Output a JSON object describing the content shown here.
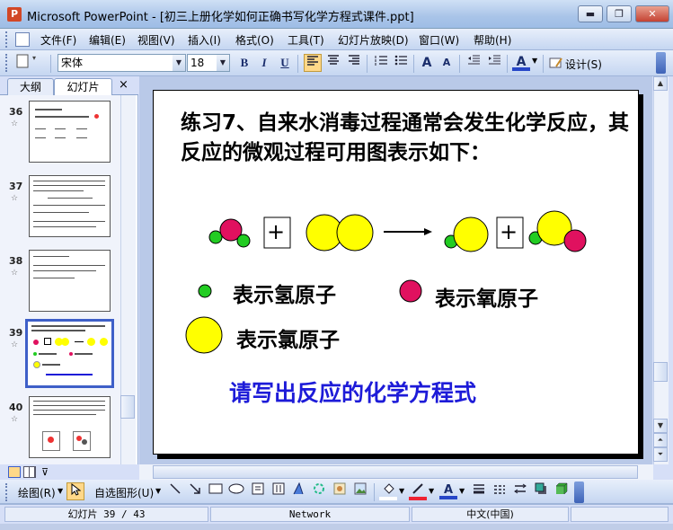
{
  "window": {
    "title": "Microsoft PowerPoint - [初三上册化学如何正确书写化学方程式课件.ppt]",
    "minimize": "▬",
    "maximize": "❐",
    "close": "✕"
  },
  "menu": [
    "文件(F)",
    "编辑(E)",
    "视图(V)",
    "插入(I)",
    "格式(O)",
    "工具(T)",
    "幻灯片放映(D)",
    "窗口(W)",
    "帮助(H)"
  ],
  "toolbar": {
    "font": "宋体",
    "size": "18",
    "bold": "B",
    "italic": "I",
    "underline": "U",
    "grow_font": "A",
    "shrink_font": "A",
    "font_color": "A",
    "design": "设计(S)"
  },
  "pane": {
    "tabs": [
      "大纲",
      "幻灯片"
    ],
    "close": "×",
    "slides": [
      {
        "number": "36",
        "star": "☆"
      },
      {
        "number": "37",
        "star": "☆"
      },
      {
        "number": "38",
        "star": "☆"
      },
      {
        "number": "39",
        "star": "☆"
      },
      {
        "number": "40",
        "star": "☆"
      }
    ]
  },
  "slide": {
    "title": "练习7、自来水消毒过程通常会发生化学反应，其反应的微观过程可用图表示如下：",
    "plus": "+",
    "legend": {
      "hydrogen": "表示氢原子",
      "oxygen": "表示氧原子",
      "chlorine": "表示氯原子"
    },
    "prompt": "请写出反应的化学方程式",
    "colors": {
      "hydrogen": "#22cc22",
      "oxygen": "#e0115f",
      "chlorine": "#ffff00",
      "prompt": "#1d1bd8"
    }
  },
  "drawing_toolbar": {
    "draw": "绘图(R)",
    "autoshapes": "自选图形(U)"
  },
  "status": {
    "slide": "幻灯片 39 / 43",
    "template": "Network",
    "language": "中文(中国)"
  }
}
